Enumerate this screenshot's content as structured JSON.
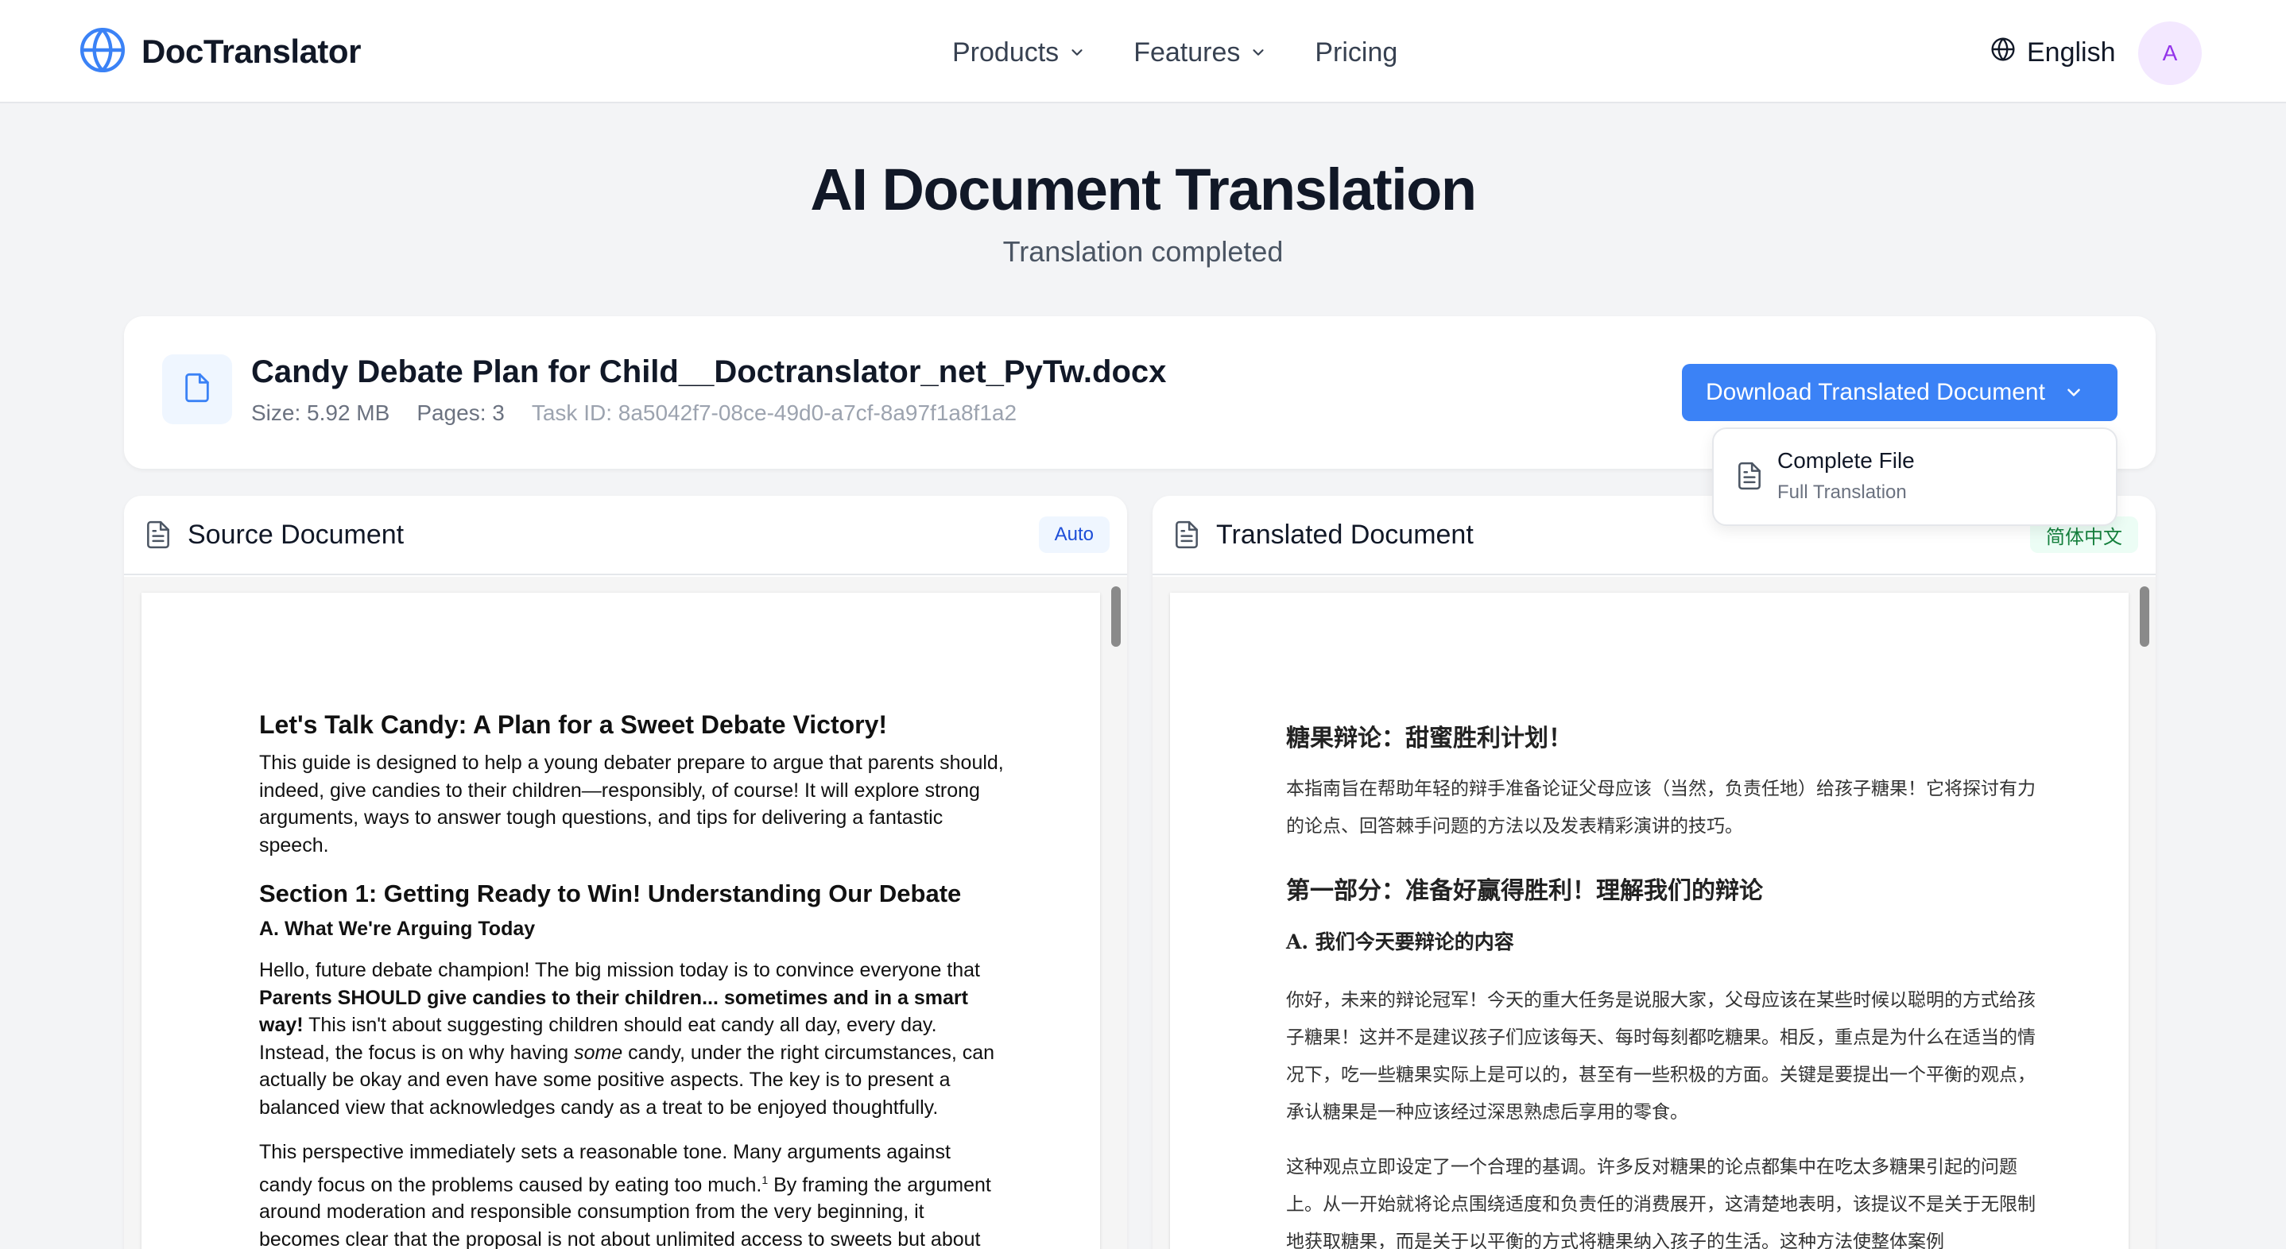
{
  "header": {
    "brand": "DocTranslator",
    "nav": [
      "Products",
      "Features",
      "Pricing"
    ],
    "language": "English",
    "avatar_initial": "A"
  },
  "hero": {
    "title": "AI Document Translation",
    "subtitle": "Translation completed"
  },
  "file": {
    "name": "Candy Debate Plan for Child__Doctranslator_net_PyTw.docx",
    "size": "Size: 5.92 MB",
    "pages": "Pages: 3",
    "task_id": "Task ID: 8a5042f7-08ce-49d0-a7cf-8a97f1a8f1a2"
  },
  "download": {
    "button_label": "Download Translated Document",
    "menu": {
      "title": "Complete File",
      "subtitle": "Full Translation"
    }
  },
  "source_panel": {
    "title": "Source Document",
    "badge": "Auto",
    "doc": {
      "h1": "Let's Talk Candy: A Plan for a Sweet Debate Victory!",
      "intro": "This guide is designed to help a young debater prepare to argue that parents should, indeed, give candies to their children—responsibly, of course! It will explore strong arguments, ways to answer tough questions, and tips for delivering a fantastic speech.",
      "section1": "Section 1: Getting Ready to Win! Understanding Our Debate",
      "subsection_a": "A. What We're Arguing Today",
      "p1_lead": "Hello, future debate champion! The big mission today is to convince everyone that",
      "p1_bold": "Parents SHOULD give candies to their children... sometimes and in a smart way!",
      "p1_a": "This isn't about suggesting children should eat candy all day, every day. Instead, the focus is on why having",
      "p1_em": "some",
      "p1_b": "candy, under the right circumstances, can actually be okay and even have some positive aspects. The key is to present a balanced view that acknowledges candy as a treat to be enjoyed thoughtfully.",
      "p2_a": "This perspective immediately sets a reasonable tone. Many arguments against candy focus on the problems caused by eating too much.",
      "p2_sup": "1",
      "p2_b": "By framing the argument around moderation and responsible consumption from the very beginning, it becomes clear that the proposal is not about unlimited access to sweets but about incorporating"
    }
  },
  "translated_panel": {
    "title": "Translated Document",
    "badge": "简体中文",
    "doc": {
      "h1": "糖果辩论：甜蜜胜利计划！",
      "intro": "本指南旨在帮助年轻的辩手准备论证父母应该（当然，负责任地）给孩子糖果！它将探讨有力的论点、回答棘手问题的方法以及发表精彩演讲的技巧。",
      "section1": "第一部分：准备好赢得胜利！理解我们的辩论",
      "subsection_a": "A. 我们今天要辩论的内容",
      "p1": "你好，未来的辩论冠军！今天的重大任务是说服大家，父母应该在某些时候以聪明的方式给孩子糖果！这并不是建议孩子们应该每天、每时每刻都吃糖果。相反，重点是为什么在适当的情况下，吃一些糖果实际上是可以的，甚至有一些积极的方面。关键是要提出一个平衡的观点，承认糖果是一种应该经过深思熟虑后享用的零食。",
      "p2": "这种观点立即设定了一个合理的基调。许多反对糖果的论点都集中在吃太多糖果引起的问题上。从一开始就将论点围绕适度和负责任的消费展开，这清楚地表明，该提议不是关于无限制地获取糖果，而是关于以平衡的方式将糖果纳入孩子的生活。这种方法使整体案例"
    }
  },
  "colors": {
    "primary": "#3b82f6",
    "avatar_bg": "#f3e8ff",
    "avatar_text": "#9333ea"
  }
}
